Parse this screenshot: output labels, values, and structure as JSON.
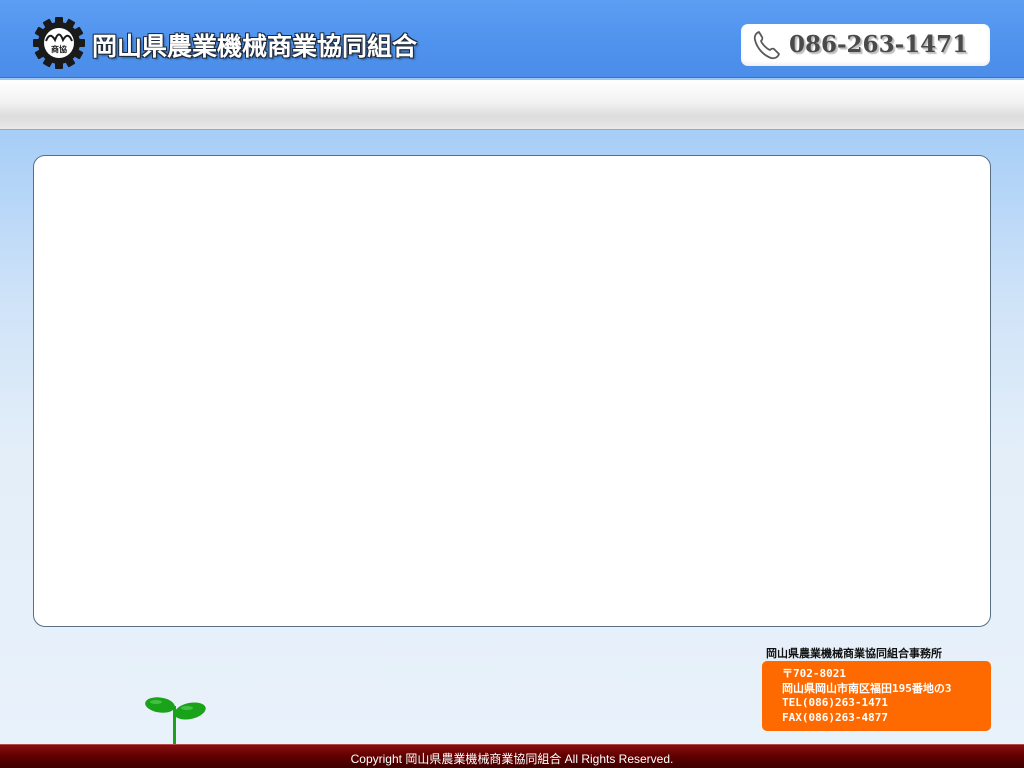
{
  "header": {
    "logo_icon": "gear-association-logo-icon",
    "logo_text": "商協",
    "title": "岡山県農業機械商業協同組合",
    "phone_icon": "telephone-handset-icon",
    "phone": "086-263-1471"
  },
  "nav": {
    "items": []
  },
  "content": {
    "body": ""
  },
  "office": {
    "name": "岡山県農業機械商業協同組合事務所",
    "address_lines": [
      "〒702-8021",
      "岡山県岡山市南区福田195番地の3",
      "TEL(086)263-1471",
      "FAX(086)263-4877"
    ]
  },
  "decoration": {
    "sprout_icon": "sprout-icon"
  },
  "footer": {
    "copyright": "Copyright 岡山県農業機械商業協同組合 All Rights Reserved."
  },
  "colors": {
    "header_blue": "#4f93ee",
    "address_orange": "#ff6a00",
    "footer_maroon": "#5e0000",
    "sprout_green": "#1aa31a"
  }
}
